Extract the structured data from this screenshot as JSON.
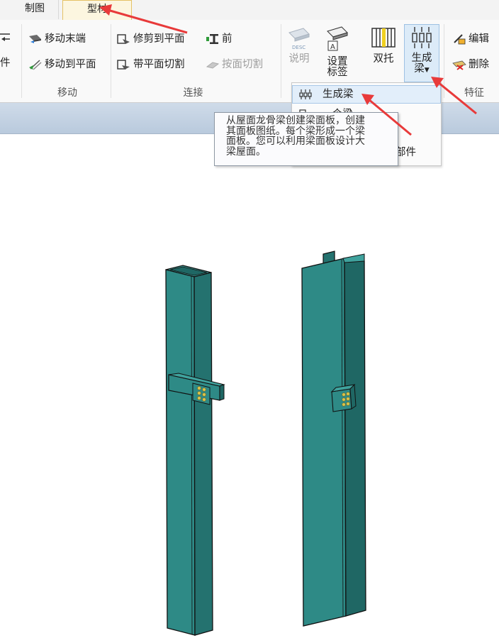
{
  "tabs": {
    "drawing": "制图",
    "profile": "型材"
  },
  "ribbon": {
    "left_cut_label": "件",
    "move_end": "移动末端",
    "move_to_plane": "移动到平面",
    "trim_to_plane": "修剪到平面",
    "front": "前",
    "cut_with_plane": "带平面切割",
    "cut_by_plane": "按面切割",
    "desc_label": "说明",
    "desc_icon_text": "DESC",
    "set_label_line1": "设置",
    "set_label_line2": "标签",
    "set_icon_text": "A",
    "double_support": "双托",
    "gen_beam_line1": "生成",
    "gen_beam_line2": "梁",
    "edit": "编辑",
    "delete": "删除",
    "groups": {
      "move": "移动",
      "connect": "连接",
      "feature": "特征"
    }
  },
  "dropdown": {
    "items": [
      {
        "label": "生成梁"
      },
      {
        "label": "一个梁"
      },
      {
        "label": "部件"
      }
    ]
  },
  "tooltip": {
    "lines": [
      "从屋面龙骨梁创建梁面板，创建",
      "其面板图纸。每个梁形成一个梁",
      "面板。您可以利用梁面板设计大",
      "梁屋面。"
    ]
  },
  "colors": {
    "annotation_arrow": "#e83a3a",
    "steel": "#2e8a86",
    "steel_dark": "#1f6764",
    "steel_light": "#3fa29d",
    "bolt": "#d9c24a"
  }
}
